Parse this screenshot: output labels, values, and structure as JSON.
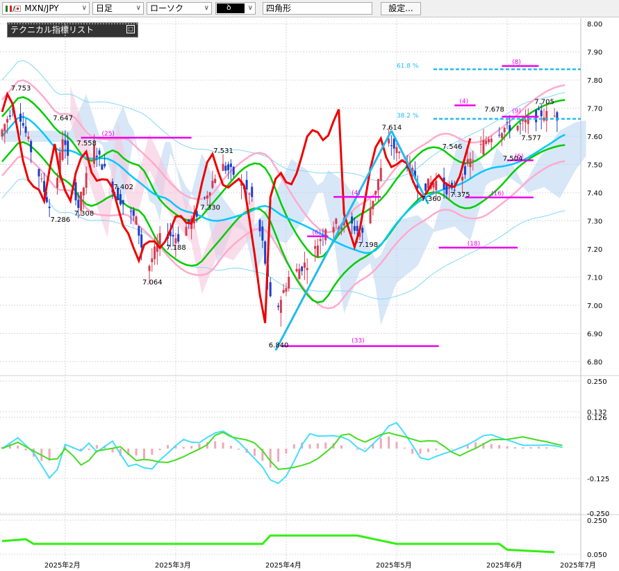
{
  "toolbar": {
    "pair": "MXN/JPY",
    "timeframe": "日足",
    "chart_style": "ローソク",
    "tool_box": "",
    "drawing_shape": "四角形",
    "settings_button": "設定..."
  },
  "indicator_list": {
    "title": "テクニカル指標リスト",
    "collapse_icon": "collapse-icon"
  },
  "colors": {
    "up": "#d63a4f",
    "down": "#1f3ec8",
    "ma_short": "#00cc00",
    "ma_long": "#00c8ff",
    "bollinger": "#ffaacc",
    "bollinger_outer": "#80d8f8",
    "rsi_line": "#ee0000",
    "trend_line": "#22bbee",
    "fib_line": "#22bbee",
    "marker": "#ee00ee",
    "cloud": "#b8d4f0"
  },
  "chart_data": [
    {
      "type": "candlestick",
      "price_axis": [
        "8.00",
        "7.90",
        "7.80",
        "7.70",
        "7.60",
        "7.50",
        "7.40",
        "7.30",
        "7.20",
        "7.10",
        "7.00",
        "6.90",
        "6.80"
      ],
      "ylim": [
        6.78,
        8.02
      ],
      "date_axis": [
        "2025年2月",
        "2025年3月",
        "2025年4月",
        "2025年5月",
        "2025年6月",
        "2025年7月"
      ],
      "price_labels": [
        {
          "text": "7.753",
          "value": 7.753,
          "day": 6
        },
        {
          "text": "7.647",
          "value": 7.647,
          "day": 22
        },
        {
          "text": "7.558",
          "value": 7.558,
          "day": 31
        },
        {
          "text": "7.286",
          "value": 7.286,
          "day": 21
        },
        {
          "text": "7.308",
          "value": 7.308,
          "day": 30
        },
        {
          "text": "7.402",
          "value": 7.402,
          "day": 45
        },
        {
          "text": "7.064",
          "value": 7.064,
          "day": 56
        },
        {
          "text": "7.188",
          "value": 7.188,
          "day": 65
        },
        {
          "text": "7.531",
          "value": 7.531,
          "day": 83
        },
        {
          "text": "7.330",
          "value": 7.33,
          "day": 78
        },
        {
          "text": "6.840",
          "value": 6.84,
          "day": 104
        },
        {
          "text": "7.198",
          "value": 7.198,
          "day": 138
        },
        {
          "text": "7.614",
          "value": 7.614,
          "day": 147
        },
        {
          "text": "7.546",
          "value": 7.546,
          "day": 170
        },
        {
          "text": "7.360",
          "value": 7.36,
          "day": 162
        },
        {
          "text": "7.375",
          "value": 7.375,
          "day": 173
        },
        {
          "text": "7.678",
          "value": 7.678,
          "day": 186
        },
        {
          "text": "7.504",
          "value": 7.504,
          "day": 193
        },
        {
          "text": "7.577",
          "value": 7.577,
          "day": 200
        },
        {
          "text": "7.705",
          "value": 7.705,
          "day": 205
        }
      ],
      "annotations": [
        {
          "text": "(25)",
          "value": 7.595,
          "day": 40
        },
        {
          "text": "(6)",
          "value": 7.245,
          "day": 120
        },
        {
          "text": "(4)",
          "value": 7.385,
          "day": 135
        },
        {
          "text": "(4)",
          "value": 7.71,
          "day": 176
        },
        {
          "text": "(8)",
          "value": 7.85,
          "day": 196
        },
        {
          "text": "(9)",
          "value": 7.675,
          "day": 196
        },
        {
          "text": "(6)",
          "value": 7.515,
          "day": 197
        },
        {
          "text": "(16)",
          "value": 7.383,
          "day": 188
        },
        {
          "text": "(18)",
          "value": 7.205,
          "day": 179
        },
        {
          "text": "(33)",
          "value": 6.86,
          "day": 135
        }
      ],
      "fibonacci": [
        {
          "text": "61.8 %",
          "value": 7.838
        },
        {
          "text": "38.2 %",
          "value": 7.662
        }
      ]
    },
    {
      "type": "line",
      "axis": [
        "0.250",
        "0.132",
        "0.126",
        "-0.125",
        "-0.250"
      ]
    },
    {
      "type": "line",
      "axis": [
        "0.250",
        "0.050"
      ]
    }
  ]
}
